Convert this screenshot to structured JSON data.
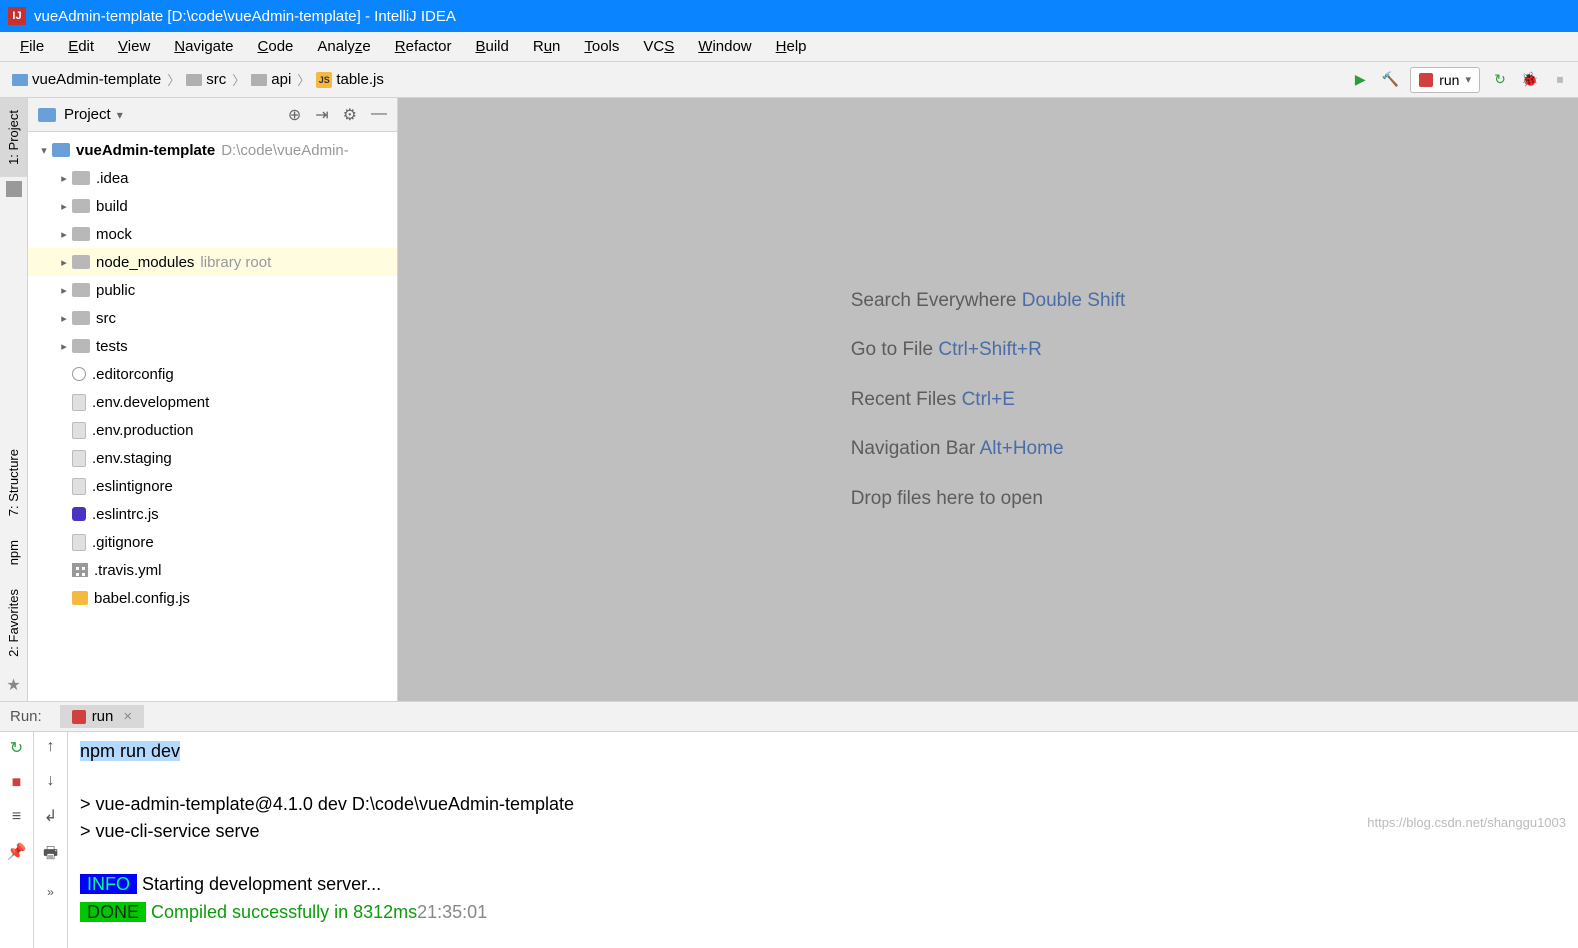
{
  "titleBar": {
    "text": "vueAdmin-template [D:\\code\\vueAdmin-template] - IntelliJ IDEA"
  },
  "menuBar": {
    "items": [
      "File",
      "Edit",
      "View",
      "Navigate",
      "Code",
      "Analyze",
      "Refactor",
      "Build",
      "Run",
      "Tools",
      "VCS",
      "Window",
      "Help"
    ]
  },
  "breadcrumbs": [
    "vueAdmin-template",
    "src",
    "api",
    "table.js"
  ],
  "runConfigLabel": "run",
  "leftTabs": {
    "project": "1: Project",
    "structure": "7: Structure",
    "npm": "npm",
    "favorites": "2: Favorites"
  },
  "projectPanel": {
    "title": "Project"
  },
  "projectTree": {
    "root": {
      "name": "vueAdmin-template",
      "hint": "D:\\code\\vueAdmin-"
    },
    "children": [
      {
        "name": ".idea",
        "type": "folder",
        "expandable": true
      },
      {
        "name": "build",
        "type": "folder",
        "expandable": true
      },
      {
        "name": "mock",
        "type": "folder",
        "expandable": true
      },
      {
        "name": "node_modules",
        "type": "folder",
        "expandable": true,
        "hint": "library root",
        "selected": true
      },
      {
        "name": "public",
        "type": "folder",
        "expandable": true
      },
      {
        "name": "src",
        "type": "folder",
        "expandable": true
      },
      {
        "name": "tests",
        "type": "folder",
        "expandable": true
      },
      {
        "name": ".editorconfig",
        "type": "cfg"
      },
      {
        "name": ".env.development",
        "type": "file"
      },
      {
        "name": ".env.production",
        "type": "file"
      },
      {
        "name": ".env.staging",
        "type": "file"
      },
      {
        "name": ".eslintignore",
        "type": "file"
      },
      {
        "name": ".eslintrc.js",
        "type": "eslint"
      },
      {
        "name": ".gitignore",
        "type": "file"
      },
      {
        "name": ".travis.yml",
        "type": "grid"
      },
      {
        "name": "babel.config.js",
        "type": "js"
      }
    ]
  },
  "placeholder": {
    "lines": [
      {
        "label": "Search Everywhere",
        "shortcut": "Double Shift"
      },
      {
        "label": "Go to File",
        "shortcut": "Ctrl+Shift+R"
      },
      {
        "label": "Recent Files",
        "shortcut": "Ctrl+E"
      },
      {
        "label": "Navigation Bar",
        "shortcut": "Alt+Home"
      },
      {
        "label": "Drop files here to open",
        "shortcut": ""
      }
    ]
  },
  "runPanel": {
    "label": "Run:",
    "tabName": "run",
    "console": {
      "cmd": "npm run dev",
      "line1": "> vue-admin-template@4.1.0 dev D:\\code\\vueAdmin-template",
      "line2": "> vue-cli-service serve",
      "info": " INFO ",
      "infoMsg": " Starting development server...",
      "done": " DONE ",
      "doneMsg": " Compiled successfully in 8312ms",
      "doneTime": "21:35:01"
    }
  },
  "watermark": "https://blog.csdn.net/shanggu1003"
}
